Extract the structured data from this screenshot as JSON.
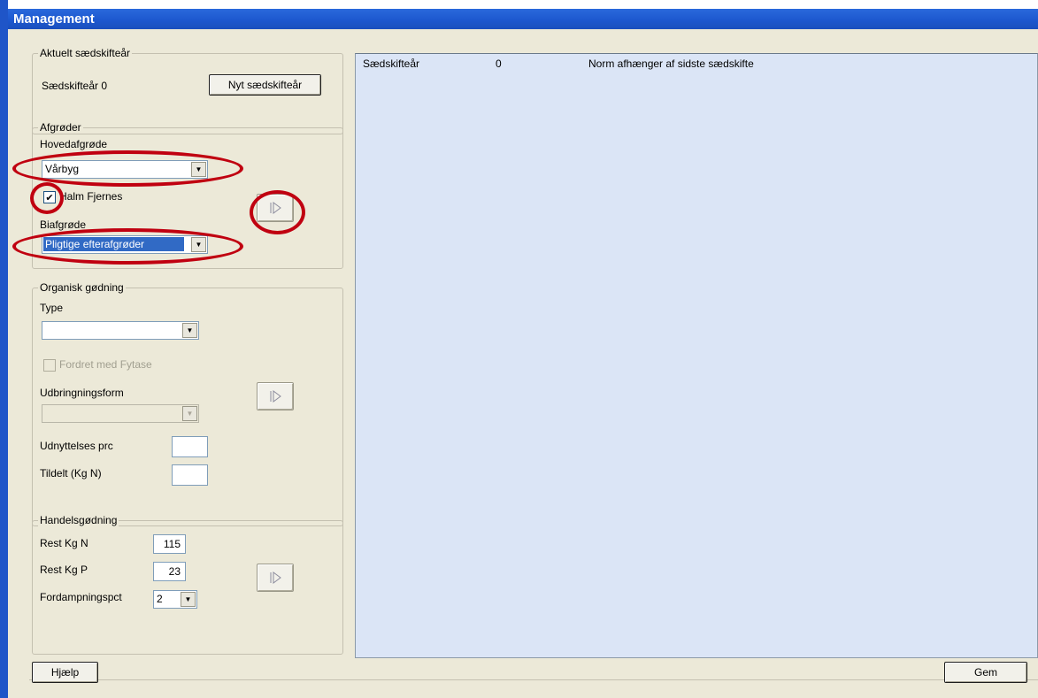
{
  "window": {
    "title": "Management"
  },
  "aktuelt": {
    "legend": "Aktuelt sædskifteår",
    "label": "Sædskifteår 0",
    "new_button": "Nyt sædskifteår"
  },
  "afgroder": {
    "legend": "Afgrøder",
    "main_crop_label": "Hovedafgrøde",
    "main_crop_value": "Vårbyg",
    "straw_removed_label": "Halm Fjernes",
    "straw_removed_checked": true,
    "catch_crop_label": "Biafgrøde",
    "catch_crop_value": "Pligtige efterafgrøder"
  },
  "organisk": {
    "legend": "Organisk gødning",
    "type_label": "Type",
    "type_value": "",
    "phytase_label": "Fordret med Fytase",
    "application_label": "Udbringningsform",
    "application_value": "",
    "utilization_label": "Udnyttelses prc",
    "utilization_value": "",
    "allocated_label": "Tildelt (Kg N)",
    "allocated_value": ""
  },
  "handels": {
    "legend": "Handelsgødning",
    "rest_n_label": "Rest Kg N",
    "rest_n_value": "115",
    "rest_p_label": "Rest Kg P",
    "rest_p_value": "23",
    "evap_label": "Fordampningspct",
    "evap_value": "2"
  },
  "result_list": {
    "rows": [
      {
        "col1": "Sædskifteår",
        "col2": "0",
        "col3": "Norm afhænger af sidste sædskifte"
      }
    ]
  },
  "footer": {
    "help_button": "Hjælp",
    "save_button": "Gem"
  },
  "colors": {
    "title_blue": "#1d58cf",
    "panel_bg": "#dbe5f6",
    "dialog_bg": "#ece9d8",
    "annotation_red": "#c00010"
  },
  "icons": {
    "arrow_button": "play-right-icon",
    "dropdown": "chevron-down-icon",
    "checkbox": "check-icon"
  }
}
